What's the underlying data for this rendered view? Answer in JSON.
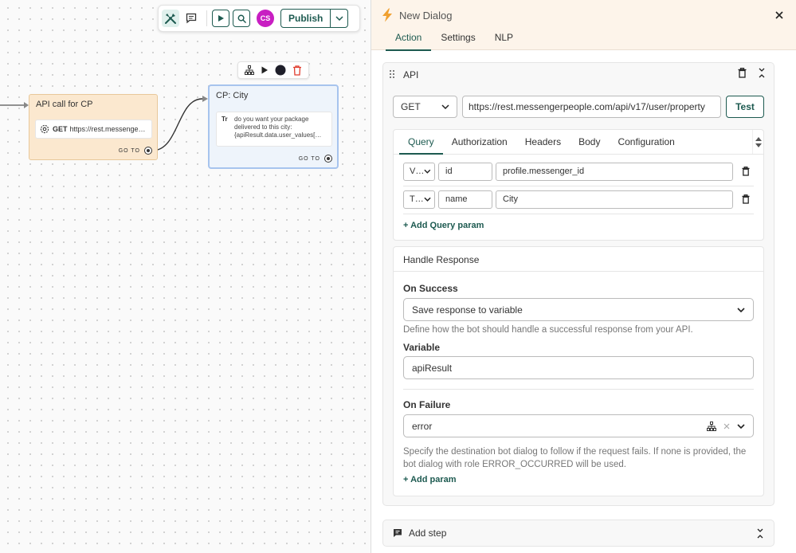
{
  "toolbar": {
    "avatar_initials": "CS",
    "publish_label": "Publish"
  },
  "canvas": {
    "api_node": {
      "title": "API call for CP",
      "method": "GET",
      "url": "https://rest.messenge…",
      "goto": "GO TO"
    },
    "city_node": {
      "title": "CP: City",
      "type_glyph": "Tr",
      "message": "do you want your package delivered to this city: {apiResult.data.user_values[…",
      "goto": "GO TO"
    }
  },
  "panel": {
    "title": "New Dialog",
    "tabs": [
      "Action",
      "Settings",
      "NLP"
    ],
    "active_tab": "Action"
  },
  "api_card": {
    "title": "API",
    "method": "GET",
    "url": "https://rest.messengerpeople.com/api/v17/user/property",
    "test_label": "Test",
    "sub_tabs": [
      "Query",
      "Authorization",
      "Headers",
      "Body",
      "Configuration"
    ],
    "active_sub_tab": "Query",
    "params": [
      {
        "type": "V…",
        "key": "id",
        "value": "profile.messenger_id"
      },
      {
        "type": "T…",
        "key": "name",
        "value": "City"
      }
    ],
    "add_query_label": "+ Add Query param"
  },
  "handle_response": {
    "title": "Handle Response",
    "on_success_label": "On Success",
    "on_success_value": "Save response to variable",
    "on_success_hint": "Define how the bot should handle a successful response from your API.",
    "variable_label": "Variable",
    "variable_value": "apiResult",
    "on_failure_label": "On Failure",
    "on_failure_value": "error",
    "on_failure_hint": "Specify the destination bot dialog to follow if the request fails. If none is provided, the bot dialog with role ERROR_OCCURRED will be used.",
    "add_param_label": "+ Add param"
  },
  "add_step": {
    "label": "Add step"
  },
  "colors": {
    "accent": "#1d5a50",
    "avatar": "#c81ec2",
    "bolt": "#f0a030",
    "delete": "#e03b2c"
  }
}
